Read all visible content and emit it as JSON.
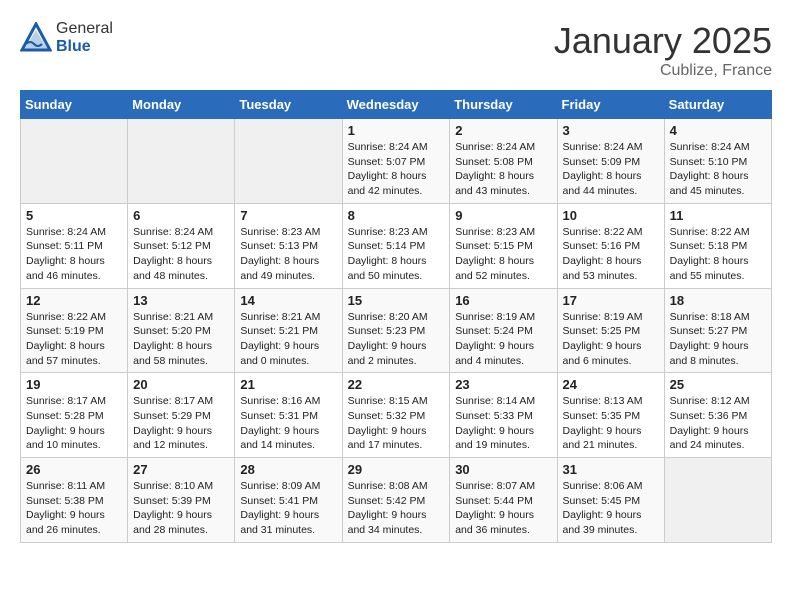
{
  "header": {
    "logo_general": "General",
    "logo_blue": "Blue",
    "month": "January 2025",
    "location": "Cublize, France"
  },
  "weekdays": [
    "Sunday",
    "Monday",
    "Tuesday",
    "Wednesday",
    "Thursday",
    "Friday",
    "Saturday"
  ],
  "weeks": [
    [
      {
        "day": "",
        "info": ""
      },
      {
        "day": "",
        "info": ""
      },
      {
        "day": "",
        "info": ""
      },
      {
        "day": "1",
        "info": "Sunrise: 8:24 AM\nSunset: 5:07 PM\nDaylight: 8 hours\nand 42 minutes."
      },
      {
        "day": "2",
        "info": "Sunrise: 8:24 AM\nSunset: 5:08 PM\nDaylight: 8 hours\nand 43 minutes."
      },
      {
        "day": "3",
        "info": "Sunrise: 8:24 AM\nSunset: 5:09 PM\nDaylight: 8 hours\nand 44 minutes."
      },
      {
        "day": "4",
        "info": "Sunrise: 8:24 AM\nSunset: 5:10 PM\nDaylight: 8 hours\nand 45 minutes."
      }
    ],
    [
      {
        "day": "5",
        "info": "Sunrise: 8:24 AM\nSunset: 5:11 PM\nDaylight: 8 hours\nand 46 minutes."
      },
      {
        "day": "6",
        "info": "Sunrise: 8:24 AM\nSunset: 5:12 PM\nDaylight: 8 hours\nand 48 minutes."
      },
      {
        "day": "7",
        "info": "Sunrise: 8:23 AM\nSunset: 5:13 PM\nDaylight: 8 hours\nand 49 minutes."
      },
      {
        "day": "8",
        "info": "Sunrise: 8:23 AM\nSunset: 5:14 PM\nDaylight: 8 hours\nand 50 minutes."
      },
      {
        "day": "9",
        "info": "Sunrise: 8:23 AM\nSunset: 5:15 PM\nDaylight: 8 hours\nand 52 minutes."
      },
      {
        "day": "10",
        "info": "Sunrise: 8:22 AM\nSunset: 5:16 PM\nDaylight: 8 hours\nand 53 minutes."
      },
      {
        "day": "11",
        "info": "Sunrise: 8:22 AM\nSunset: 5:18 PM\nDaylight: 8 hours\nand 55 minutes."
      }
    ],
    [
      {
        "day": "12",
        "info": "Sunrise: 8:22 AM\nSunset: 5:19 PM\nDaylight: 8 hours\nand 57 minutes."
      },
      {
        "day": "13",
        "info": "Sunrise: 8:21 AM\nSunset: 5:20 PM\nDaylight: 8 hours\nand 58 minutes."
      },
      {
        "day": "14",
        "info": "Sunrise: 8:21 AM\nSunset: 5:21 PM\nDaylight: 9 hours\nand 0 minutes."
      },
      {
        "day": "15",
        "info": "Sunrise: 8:20 AM\nSunset: 5:23 PM\nDaylight: 9 hours\nand 2 minutes."
      },
      {
        "day": "16",
        "info": "Sunrise: 8:19 AM\nSunset: 5:24 PM\nDaylight: 9 hours\nand 4 minutes."
      },
      {
        "day": "17",
        "info": "Sunrise: 8:19 AM\nSunset: 5:25 PM\nDaylight: 9 hours\nand 6 minutes."
      },
      {
        "day": "18",
        "info": "Sunrise: 8:18 AM\nSunset: 5:27 PM\nDaylight: 9 hours\nand 8 minutes."
      }
    ],
    [
      {
        "day": "19",
        "info": "Sunrise: 8:17 AM\nSunset: 5:28 PM\nDaylight: 9 hours\nand 10 minutes."
      },
      {
        "day": "20",
        "info": "Sunrise: 8:17 AM\nSunset: 5:29 PM\nDaylight: 9 hours\nand 12 minutes."
      },
      {
        "day": "21",
        "info": "Sunrise: 8:16 AM\nSunset: 5:31 PM\nDaylight: 9 hours\nand 14 minutes."
      },
      {
        "day": "22",
        "info": "Sunrise: 8:15 AM\nSunset: 5:32 PM\nDaylight: 9 hours\nand 17 minutes."
      },
      {
        "day": "23",
        "info": "Sunrise: 8:14 AM\nSunset: 5:33 PM\nDaylight: 9 hours\nand 19 minutes."
      },
      {
        "day": "24",
        "info": "Sunrise: 8:13 AM\nSunset: 5:35 PM\nDaylight: 9 hours\nand 21 minutes."
      },
      {
        "day": "25",
        "info": "Sunrise: 8:12 AM\nSunset: 5:36 PM\nDaylight: 9 hours\nand 24 minutes."
      }
    ],
    [
      {
        "day": "26",
        "info": "Sunrise: 8:11 AM\nSunset: 5:38 PM\nDaylight: 9 hours\nand 26 minutes."
      },
      {
        "day": "27",
        "info": "Sunrise: 8:10 AM\nSunset: 5:39 PM\nDaylight: 9 hours\nand 28 minutes."
      },
      {
        "day": "28",
        "info": "Sunrise: 8:09 AM\nSunset: 5:41 PM\nDaylight: 9 hours\nand 31 minutes."
      },
      {
        "day": "29",
        "info": "Sunrise: 8:08 AM\nSunset: 5:42 PM\nDaylight: 9 hours\nand 34 minutes."
      },
      {
        "day": "30",
        "info": "Sunrise: 8:07 AM\nSunset: 5:44 PM\nDaylight: 9 hours\nand 36 minutes."
      },
      {
        "day": "31",
        "info": "Sunrise: 8:06 AM\nSunset: 5:45 PM\nDaylight: 9 hours\nand 39 minutes."
      },
      {
        "day": "",
        "info": ""
      }
    ]
  ]
}
